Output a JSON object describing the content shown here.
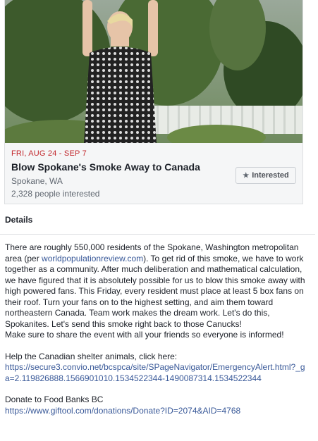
{
  "event": {
    "date": "FRI, AUG 24 - SEP 7",
    "title": "Blow Spokane's Smoke Away to Canada",
    "location": "Spokane, WA",
    "interested_count": "2,328 people interested",
    "interested_button": "Interested",
    "star_icon": "★"
  },
  "details": {
    "header": "Details",
    "para1_before_link": "There are roughly 550,000 residents of the Spokane, Washington metropolitan area (per ",
    "para1_link": "worldpopulationreview.com",
    "para1_after_link": "). To get rid of this smoke, we have to work together as a community. After much deliberation and mathematical calculation, we have figured that it is absolutely possible for us to blow this smoke away with high powered fans. This Friday, every resident must place at least 5 box fans on their roof. Turn your fans on to the highest setting, and aim them toward northeastern Canada. Team work makes the dream work. Let's do this, Spokanites. Let's send this smoke right back to those Canucks!",
    "para2": "Make sure to share the event with all your friends so everyone is informed!",
    "para3": "Help the Canadian shelter animals, click here:",
    "link1": "https://secure3.convio.net/bcspca/site/SPageNavigator/EmergencyAlert.html?_ga=2.119826888.1566901010.1534522344-1490087314.1534522344",
    "para4": "Donate to Food Banks BC",
    "link2": "https://www.giftool.com/donations/Donate?ID=2074&AID=4768"
  },
  "colors": {
    "date_red": "#c2282d",
    "link_blue": "#385898",
    "bg_gray": "#f5f6f7"
  }
}
